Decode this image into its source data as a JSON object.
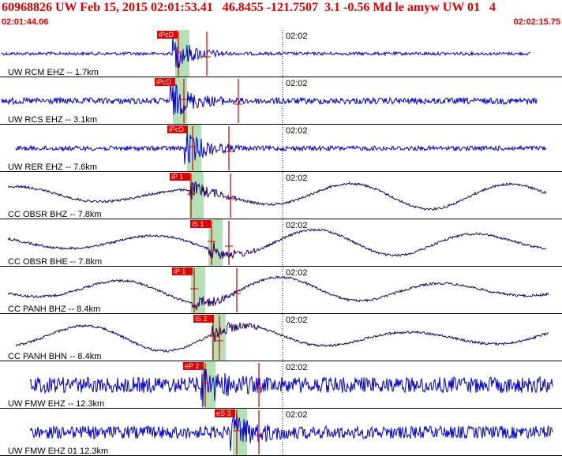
{
  "header": {
    "title": "60968826 UW Feb 15, 2015 02:01:53.41   46.8455 -121.7507  3.1 -0.56 Md le amyw UW 01   4",
    "start_time": "02:01:44.06",
    "end_time": "02:02:15.75"
  },
  "colors": {
    "header_text": "#e00000",
    "trace_blue": "#0000cc",
    "trace_dark": "#1a0066",
    "pick_box": "#e00000",
    "window_green": "#b5e0b5"
  },
  "traces": [
    {
      "label": "UW RCM EHZ -- 1.7km",
      "time_label": "02:02",
      "picks": [
        "iPcD"
      ],
      "style": "blue",
      "amp": 2
    },
    {
      "label": "UW RCS EHZ -- 3.1km",
      "time_label": "02:02",
      "picks": [
        "iPcD"
      ],
      "style": "blue",
      "amp": 4
    },
    {
      "label": "UW RER EHZ -- 7.6km",
      "time_label": "02:02",
      "picks": [
        "iPcD"
      ],
      "style": "blue",
      "amp": 3
    },
    {
      "label": "CC OBSR BHZ -- 7.8km",
      "time_label": "02:02",
      "picks": [
        "iP 1"
      ],
      "style": "dark",
      "amp": 0
    },
    {
      "label": "CC OBSR BHE -- 7.8km",
      "time_label": "02:02",
      "picks": [
        "iS 1"
      ],
      "style": "dark",
      "amp": 0
    },
    {
      "label": "CC PANH BHZ -- 8.4km",
      "time_label": "02:02",
      "picks": [
        "iP 1"
      ],
      "style": "dark",
      "amp": 0
    },
    {
      "label": "CC PANH BHN -- 8.4km",
      "time_label": "02:02",
      "picks": [
        "iS 2"
      ],
      "style": "dark",
      "amp": 0
    },
    {
      "label": "UW FMW EHZ -- 12.3km",
      "time_label": "02:02",
      "picks": [
        "eP 2"
      ],
      "style": "blue",
      "amp": 10
    },
    {
      "label": "UW FMW EHZ 01 12.3km",
      "time_label": "02:02",
      "picks": [
        "eS 3"
      ],
      "style": "blue",
      "amp": 8
    }
  ]
}
